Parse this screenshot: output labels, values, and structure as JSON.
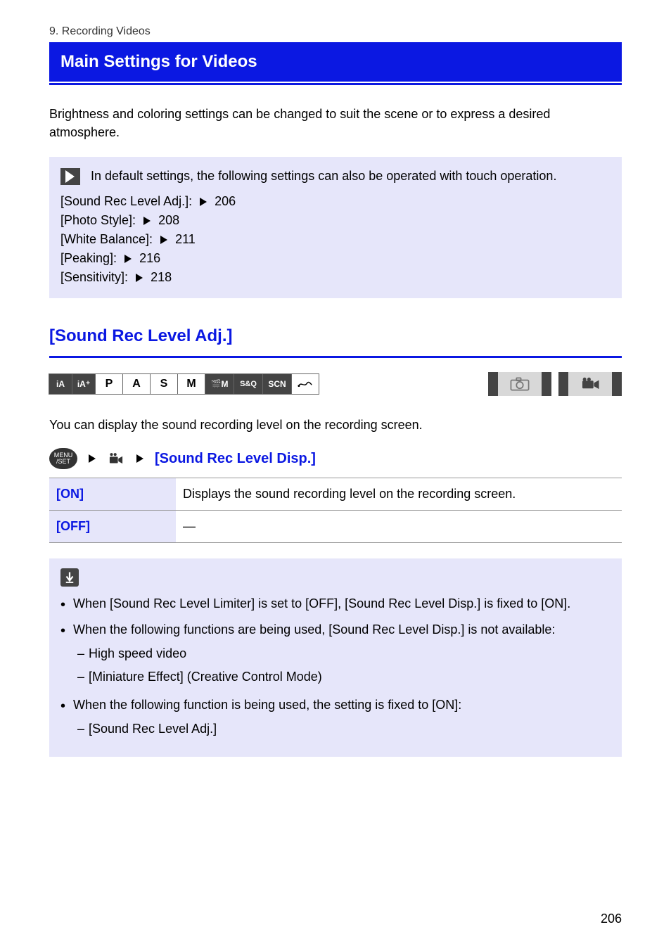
{
  "breadcrumb": "9. Recording Videos",
  "title": "Main Settings for Videos",
  "intro": "Brightness and coloring settings can be changed to suit the scene or to express a desired atmosphere.",
  "tip": {
    "lead": "In default settings, the following settings can also be operated with touch operation.",
    "items": [
      {
        "label": "[Sound Rec Level Adj.]:",
        "ref": "206"
      },
      {
        "label": "[Photo Style]:",
        "ref": "208"
      },
      {
        "label": "[White Balance]:",
        "ref": "211"
      },
      {
        "label": "[Peaking]:",
        "ref": "216"
      },
      {
        "label": "[Sensitivity]:",
        "ref": "218"
      }
    ]
  },
  "section_title": "[Sound Rec Level Adj.]",
  "sub_lead": "You can display the sound recording level on the recording screen.",
  "menu_label": "[Sound Rec Level Disp.]",
  "options": {
    "on": {
      "key": "[ON]",
      "desc": "Displays the sound recording level on the recording screen."
    },
    "off": {
      "key": "[OFF]",
      "desc": "—"
    }
  },
  "notes": {
    "bullets": [
      "When [Sound Rec Level Limiter] is set to [OFF], [Sound Rec Level Disp.] is fixed to [ON].",
      "When the following functions are being used, [Sound Rec Level Disp.] is not available:"
    ],
    "subitems": [
      "High speed video",
      "[Miniature Effect] (Creative Control Mode)"
    ],
    "tail": "When the following function is being used, the setting is fixed to [ON]:",
    "tail_sub": "[Sound Rec Level Adj.]"
  },
  "page_number": "206"
}
